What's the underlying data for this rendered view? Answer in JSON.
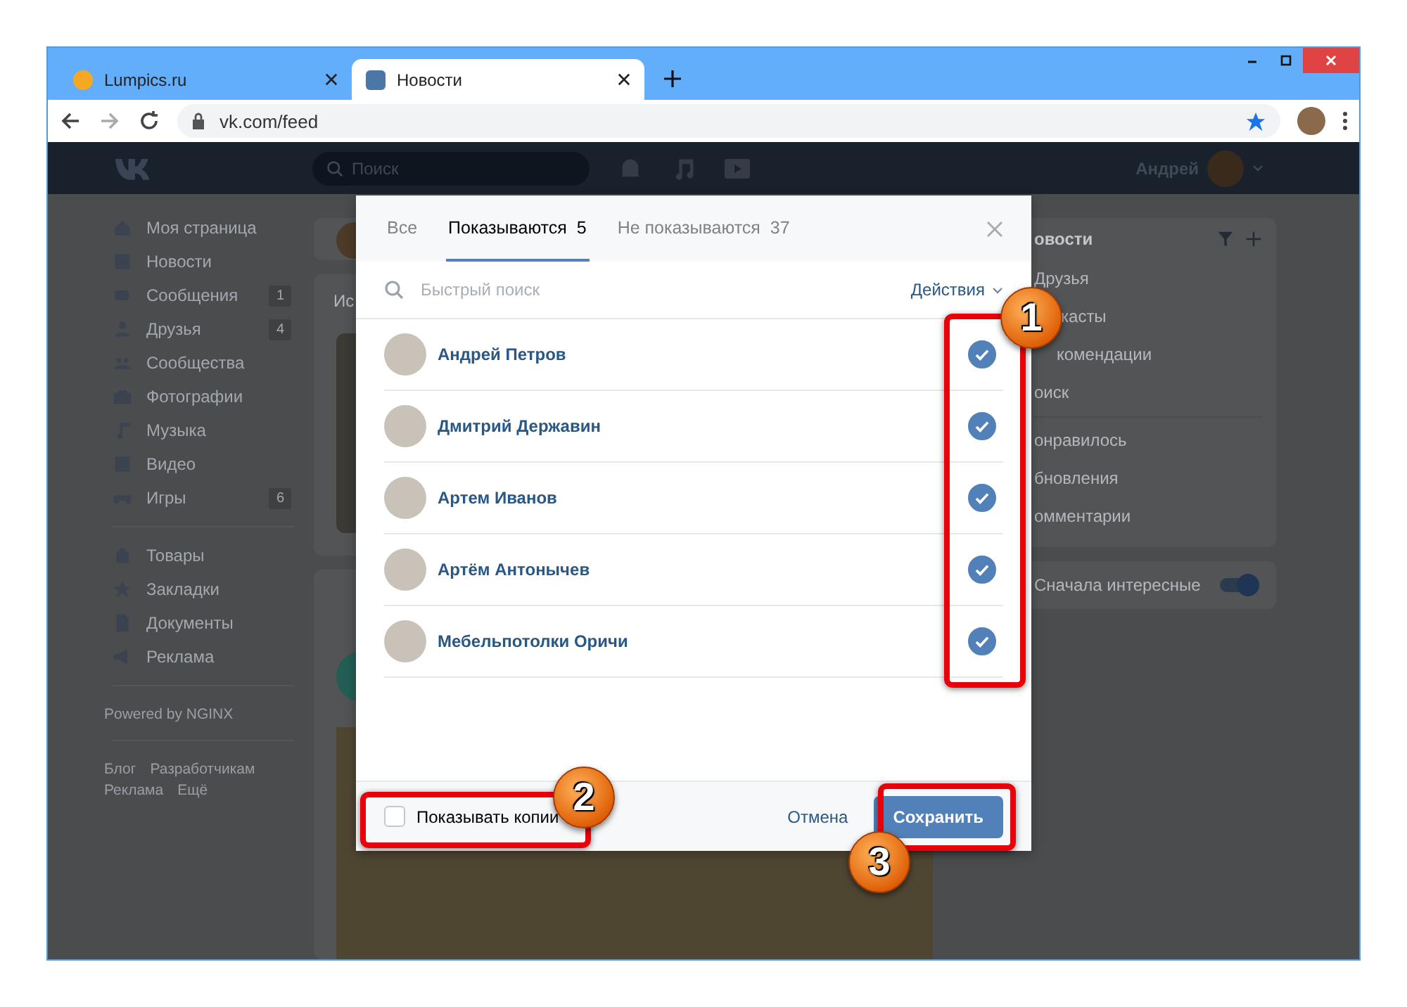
{
  "browser": {
    "tabs": [
      {
        "title": "Lumpics.ru",
        "selected": false
      },
      {
        "title": "Новости",
        "selected": true
      }
    ],
    "url": "vk.com/feed"
  },
  "header": {
    "search_placeholder": "Поиск",
    "user_name": "Андрей"
  },
  "sidebar": {
    "items": [
      {
        "label": "Моя страница"
      },
      {
        "label": "Новости"
      },
      {
        "label": "Сообщения",
        "badge": "1"
      },
      {
        "label": "Друзья",
        "badge": "4"
      },
      {
        "label": "Сообщества"
      },
      {
        "label": "Фотографии"
      },
      {
        "label": "Музыка"
      },
      {
        "label": "Видео"
      },
      {
        "label": "Игры",
        "badge": "6"
      }
    ],
    "items_2": [
      {
        "label": "Товары"
      },
      {
        "label": "Закладки"
      },
      {
        "label": "Документы"
      },
      {
        "label": "Реклама"
      }
    ],
    "powered": "Powered by NGINX",
    "footer_links": [
      "Блог",
      "Разработчикам",
      "Реклама",
      "Ещё"
    ]
  },
  "feed": {
    "story_title": "Ис"
  },
  "right_panel": {
    "title": "овости",
    "items": [
      "Друзья",
      "касты",
      "комендации",
      "оиск"
    ],
    "items_2": [
      "онравилось",
      "бновления",
      "омментарии"
    ],
    "toggle": {
      "label": "Сначала интересные",
      "on": true
    }
  },
  "dialog": {
    "tabs": [
      {
        "label": "Все",
        "selected": false
      },
      {
        "label": "Показываются",
        "count": "5",
        "selected": true
      },
      {
        "label": "Не показываются",
        "count": "37",
        "selected": false
      }
    ],
    "search_placeholder": "Быстрый поиск",
    "actions": "Действия",
    "people": [
      {
        "name": "Андрей Петров",
        "checked": true
      },
      {
        "name": "Дмитрий Державин",
        "checked": true
      },
      {
        "name": "Артем Иванов",
        "checked": true
      },
      {
        "name": "Артём Антонычев",
        "checked": true
      },
      {
        "name": "Мебельпотолки Оричи",
        "checked": true
      }
    ],
    "show_copies": {
      "label": "Показывать копии",
      "checked": false
    },
    "cancel": "Отмена",
    "save": "Сохранить"
  },
  "annotations": [
    {
      "label": "1"
    },
    {
      "label": "2"
    },
    {
      "label": "3"
    }
  ]
}
